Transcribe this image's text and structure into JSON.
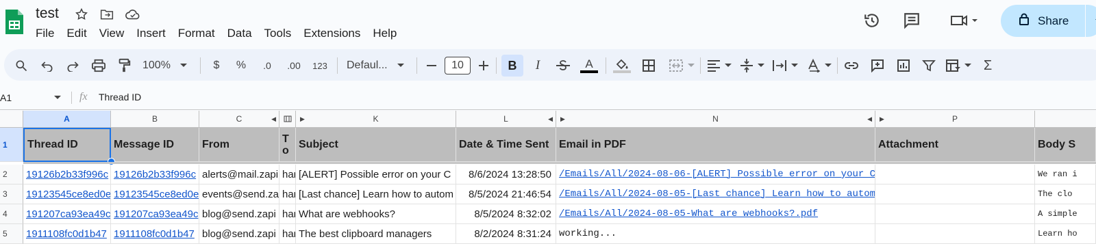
{
  "app": {
    "doc_title": "test",
    "menu": [
      "File",
      "Edit",
      "View",
      "Insert",
      "Format",
      "Data",
      "Tools",
      "Extensions",
      "Help"
    ],
    "share_label": "Share"
  },
  "toolbar": {
    "zoom": "100%",
    "currency": "$",
    "percent": "%",
    "dec_decrease": ".0",
    "dec_increase": ".00",
    "number_format": "123",
    "font": "Defaul...",
    "font_size": "10",
    "bold": "B",
    "italic": "I",
    "text_color": "A",
    "sum": "Σ"
  },
  "formula_bar": {
    "cell_ref": "A1",
    "fx": "fx",
    "content": "Thread ID"
  },
  "columns": [
    "A",
    "B",
    "C",
    "K",
    "L",
    "N",
    "P"
  ],
  "rows": {
    "numbers": [
      "1",
      "2",
      "3",
      "4",
      "5"
    ],
    "header": {
      "a": "Thread ID",
      "b": "Message ID",
      "c": "From",
      "to": "T o",
      "k": "Subject",
      "l": "Date & Time Sent",
      "n": "Email in PDF",
      "p": "Attachment",
      "body": "Body S"
    },
    "data": [
      {
        "a": "19126b2b33f996c",
        "b": "19126b2b33f996c",
        "c": "alerts@mail.zapi",
        "to": "har",
        "k": "[ALERT] Possible error on your C",
        "l": "8/6/2024 13:28:50",
        "n": "/Emails/All/2024-08-06-[ALERT] Possible error on your C",
        "body": "We ran i"
      },
      {
        "a": "19123545ce8ed0e",
        "b": "19123545ce8ed0e",
        "c": "events@send.za",
        "to": "har",
        "k": "[Last chance] Learn how to autom",
        "l": "8/5/2024 21:46:54",
        "n": "/Emails/All/2024-08-05-[Last chance] Learn how to autom",
        "body": "The clo"
      },
      {
        "a": "191207ca93ea49c",
        "b": "191207ca93ea49c",
        "c": "blog@send.zapi",
        "to": "har",
        "k": "What are webhooks?",
        "l": "8/5/2024 8:32:02",
        "n": "/Emails/All/2024-08-05-What are webhooks?.pdf",
        "body": "A simple"
      },
      {
        "a": "1911108fc0d1b47",
        "b": "1911108fc0d1b47",
        "c": "blog@send.zapi",
        "to": "har",
        "k": "The best clipboard managers",
        "l": "8/2/2024 8:31:24",
        "n": "working...",
        "body": "Learn ho"
      }
    ]
  }
}
